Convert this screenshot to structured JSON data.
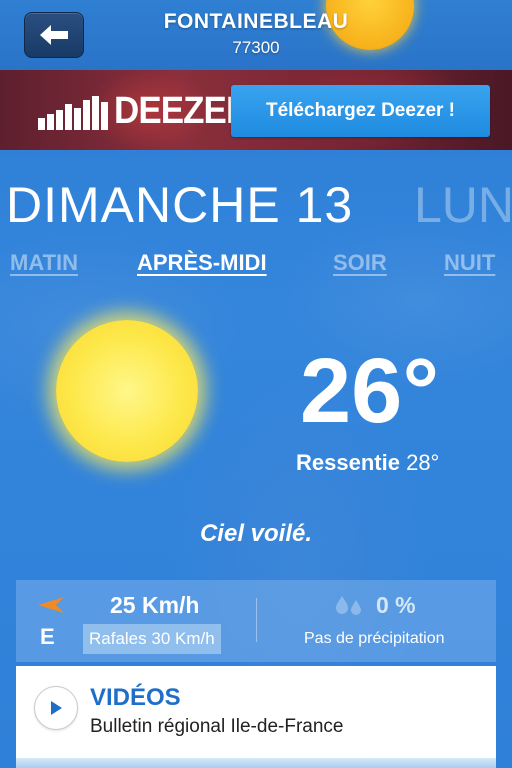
{
  "header": {
    "city": "FONTAINEBLEAU",
    "postal_code": "77300",
    "back_icon": "arrow-left-icon"
  },
  "ad": {
    "brand": "DEEZER",
    "cta": "Téléchargez Deezer !"
  },
  "day": {
    "current": "DIMANCHE 13",
    "next": "LUN"
  },
  "periods": [
    {
      "label": "MATIN",
      "active": false
    },
    {
      "label": "APRÈS-MIDI",
      "active": true
    },
    {
      "label": "SOIR",
      "active": false
    },
    {
      "label": "NUIT",
      "active": false
    }
  ],
  "weather": {
    "icon": "sun-icon",
    "temperature": "26°",
    "feels_label": "Ressentie",
    "feels_value": "28°",
    "sky": "Ciel voilé."
  },
  "wind": {
    "direction": "E",
    "speed": "25 Km/h",
    "gusts": "Rafales 30 Km/h",
    "icon": "wind-direction-arrow-icon"
  },
  "precipitation": {
    "value": "0 %",
    "label": "Pas de précipitation",
    "icon": "raindrops-icon"
  },
  "video": {
    "title": "VIDÉOS",
    "subtitle": "Bulletin régional Ile-de-France",
    "icon": "play-icon"
  },
  "colors": {
    "background_blue": "#2f80d8",
    "accent_blue": "#1f6fc9",
    "cta_blue": "#1f8be0",
    "wind_arrow_orange": "#f08a24",
    "sun_yellow": "#fde84a"
  }
}
